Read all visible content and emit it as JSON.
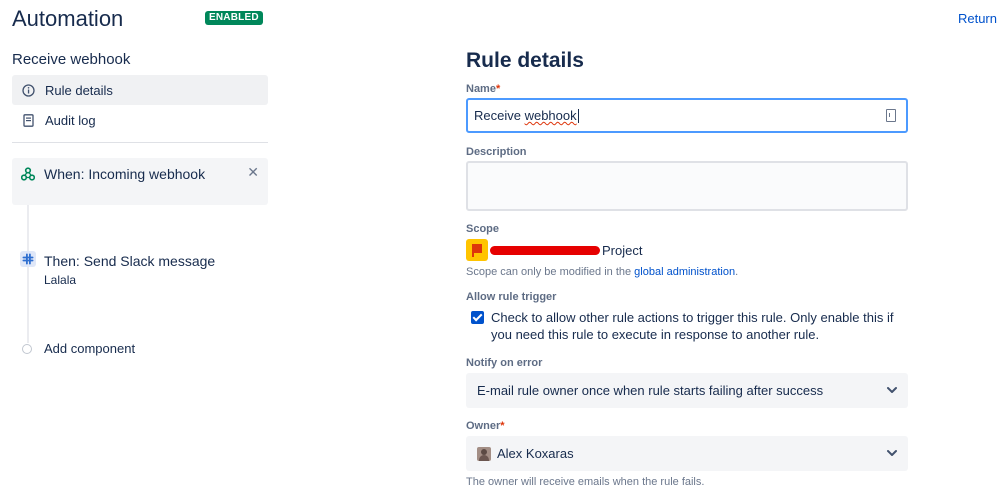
{
  "header": {
    "title": "Automation",
    "status_badge": "ENABLED",
    "return_label": "Return"
  },
  "sidebar": {
    "rule_name": "Receive webhook",
    "items": [
      {
        "label": "Rule details",
        "icon": "info-icon",
        "active": true
      },
      {
        "label": "Audit log",
        "icon": "document-icon",
        "active": false
      }
    ]
  },
  "flow": {
    "trigger": {
      "label": "When: Incoming webhook",
      "icon": "webhook-icon"
    },
    "action": {
      "label": "Then: Send Slack message",
      "sublabel": "Lalala",
      "icon": "slack-icon"
    },
    "add_component_label": "Add component"
  },
  "form": {
    "title": "Rule details",
    "name": {
      "label": "Name",
      "required_mark": "*",
      "value_prefix": "Receive ",
      "value_suffix": "webhook"
    },
    "description": {
      "label": "Description",
      "value": ""
    },
    "scope": {
      "label": "Scope",
      "project_suffix": "Project",
      "help_prefix": "Scope can only be modified in the ",
      "help_link": "global administration",
      "help_suffix": "."
    },
    "allow_trigger": {
      "label": "Allow rule trigger",
      "checked": true,
      "text": "Check to allow other rule actions to trigger this rule. Only enable this if you need this rule to execute in response to another rule."
    },
    "notify": {
      "label": "Notify on error",
      "selected": "E-mail rule owner once when rule starts failing after success"
    },
    "owner": {
      "label": "Owner",
      "required_mark": "*",
      "selected": "Alex Koxaras",
      "help": "The owner will receive emails when the rule fails."
    }
  },
  "colors": {
    "accent": "#0052cc",
    "enabled_badge": "#00875a",
    "focus_border": "#4c9aff",
    "required": "#de350b"
  }
}
